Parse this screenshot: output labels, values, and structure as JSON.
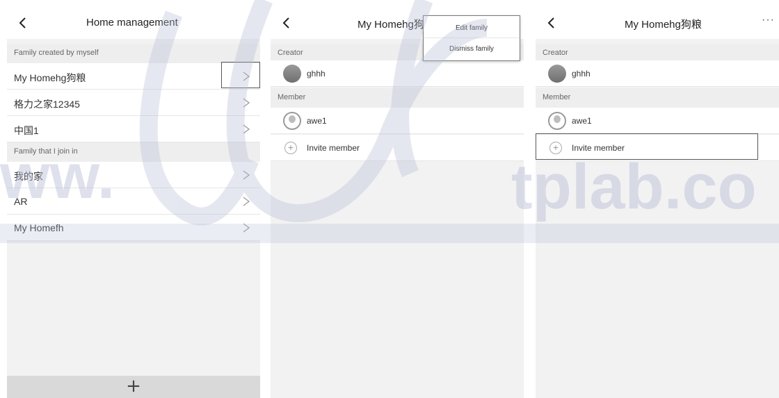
{
  "screen1": {
    "title": "Home management",
    "section_created": "Family created by myself",
    "created_families": [
      "My Homehg狗粮",
      "格力之家12345",
      "中国1"
    ],
    "section_joined": "Family that I join in",
    "joined_families": [
      "我的家",
      "AR",
      "My Homefh"
    ],
    "add_label": "+"
  },
  "screen2": {
    "title": "My Homehg狗粮",
    "section_creator": "Creator",
    "creator_name": "ghhh",
    "section_member": "Member",
    "member_name": "awe1",
    "invite_label": "Invite member",
    "popup": {
      "edit": "Edit family",
      "dismiss": "Dismiss family"
    }
  },
  "screen3": {
    "title": "My Homehg狗粮",
    "more_label": "···",
    "section_creator": "Creator",
    "creator_name": "ghhh",
    "section_member": "Member",
    "member_name": "awe1",
    "invite_label": "Invite member"
  },
  "watermark": {
    "text_left": "ww.",
    "text_right": "tplab.co"
  },
  "colors": {
    "background": "#f2f2f2",
    "row": "#ffffff",
    "highlight": "#555555",
    "watermark": "#c9cde0"
  }
}
